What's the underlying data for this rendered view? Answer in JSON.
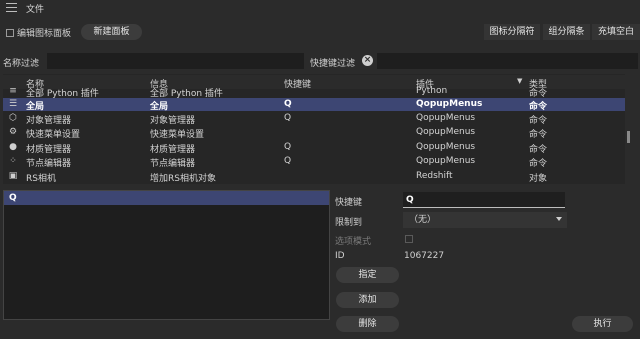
{
  "header": {
    "title": "文件"
  },
  "toolbar": {
    "edit_icon_panel": "编辑图标面板",
    "new_panel": "新建面板",
    "icon_separator": "图标分隔符",
    "group_separator": "组分隔条",
    "fill_blank": "充填空白"
  },
  "filters": {
    "name_filter": "名称过滤",
    "shortcut_filter": "快捷键过滤"
  },
  "table": {
    "columns": [
      "名称",
      "信息",
      "快捷键",
      "插件",
      "类型"
    ],
    "rows": [
      {
        "icon": "pyscript-icon",
        "name": "全部 Python 插件",
        "info": "全部 Python 插件",
        "key": "",
        "plugin": "Python",
        "type": "命令"
      },
      {
        "icon": "menu-lines-icon",
        "name": "全局",
        "info": "全局",
        "key": "Q",
        "plugin": "QopupMenus",
        "type": "命令",
        "selected": true
      },
      {
        "icon": "object-manager-icon",
        "name": "对象管理器",
        "info": "对象管理器",
        "key": "Q",
        "plugin": "QopupMenus",
        "type": "命令"
      },
      {
        "icon": "gear-icon",
        "name": "快速菜单设置",
        "info": "快速菜单设置",
        "key": "",
        "plugin": "QopupMenus",
        "type": "命令"
      },
      {
        "icon": "material-manager-icon",
        "name": "材质管理器",
        "info": "材质管理器",
        "key": "Q",
        "plugin": "QopupMenus",
        "type": "命令"
      },
      {
        "icon": "node-editor-icon",
        "name": "节点编辑器",
        "info": "节点编辑器",
        "key": "Q",
        "plugin": "QopupMenus",
        "type": "命令"
      },
      {
        "icon": "camera-icon",
        "name": "RS相机",
        "info": "增加RS相机对象",
        "key": "",
        "plugin": "Redshift",
        "type": "对象"
      }
    ]
  },
  "shortcut_list": {
    "selected": "Q"
  },
  "properties": {
    "shortcut_label": "快捷键",
    "shortcut_value": "Q",
    "restrict_label": "限制到",
    "restrict_value": "（无）",
    "option_mode_label": "选项模式",
    "id_label": "ID",
    "id_value": "1067227"
  },
  "actions": {
    "assign": "指定",
    "add": "添加",
    "delete": "删除",
    "execute": "执行"
  }
}
